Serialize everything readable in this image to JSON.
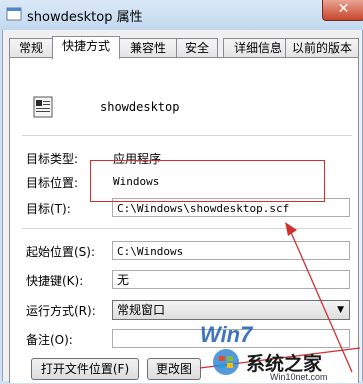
{
  "window": {
    "title": "showdesktop 属性",
    "close": "✕",
    "accent": "#c8452c"
  },
  "tabs": [
    {
      "label": "常规"
    },
    {
      "label": "快捷方式"
    },
    {
      "label": "兼容性"
    },
    {
      "label": "安全"
    },
    {
      "label": "详细信息"
    },
    {
      "label": "以前的版本"
    }
  ],
  "general": {
    "app_name": "showdesktop",
    "target_type_label": "目标类型:",
    "target_type_value": "应用程序",
    "target_location_label": "目标位置:",
    "target_location_value": "Windows",
    "target_label": "目标(T):",
    "target_value": "C:\\Windows\\showdesktop.scf",
    "start_in_label": "起始位置(S):",
    "start_in_value": "C:\\Windows",
    "shortcut_key_label": "快捷键(K):",
    "shortcut_key_value": "无",
    "run_label": "运行方式(R):",
    "run_value": "常规窗口",
    "comment_label": "备注(O):",
    "comment_value": ""
  },
  "buttons": {
    "open_location": "打开文件位置(F)",
    "change_icon": "更改图"
  },
  "watermark": {
    "logo": "Win7",
    "brand": "系统之家",
    "url": "Win10net.com"
  }
}
